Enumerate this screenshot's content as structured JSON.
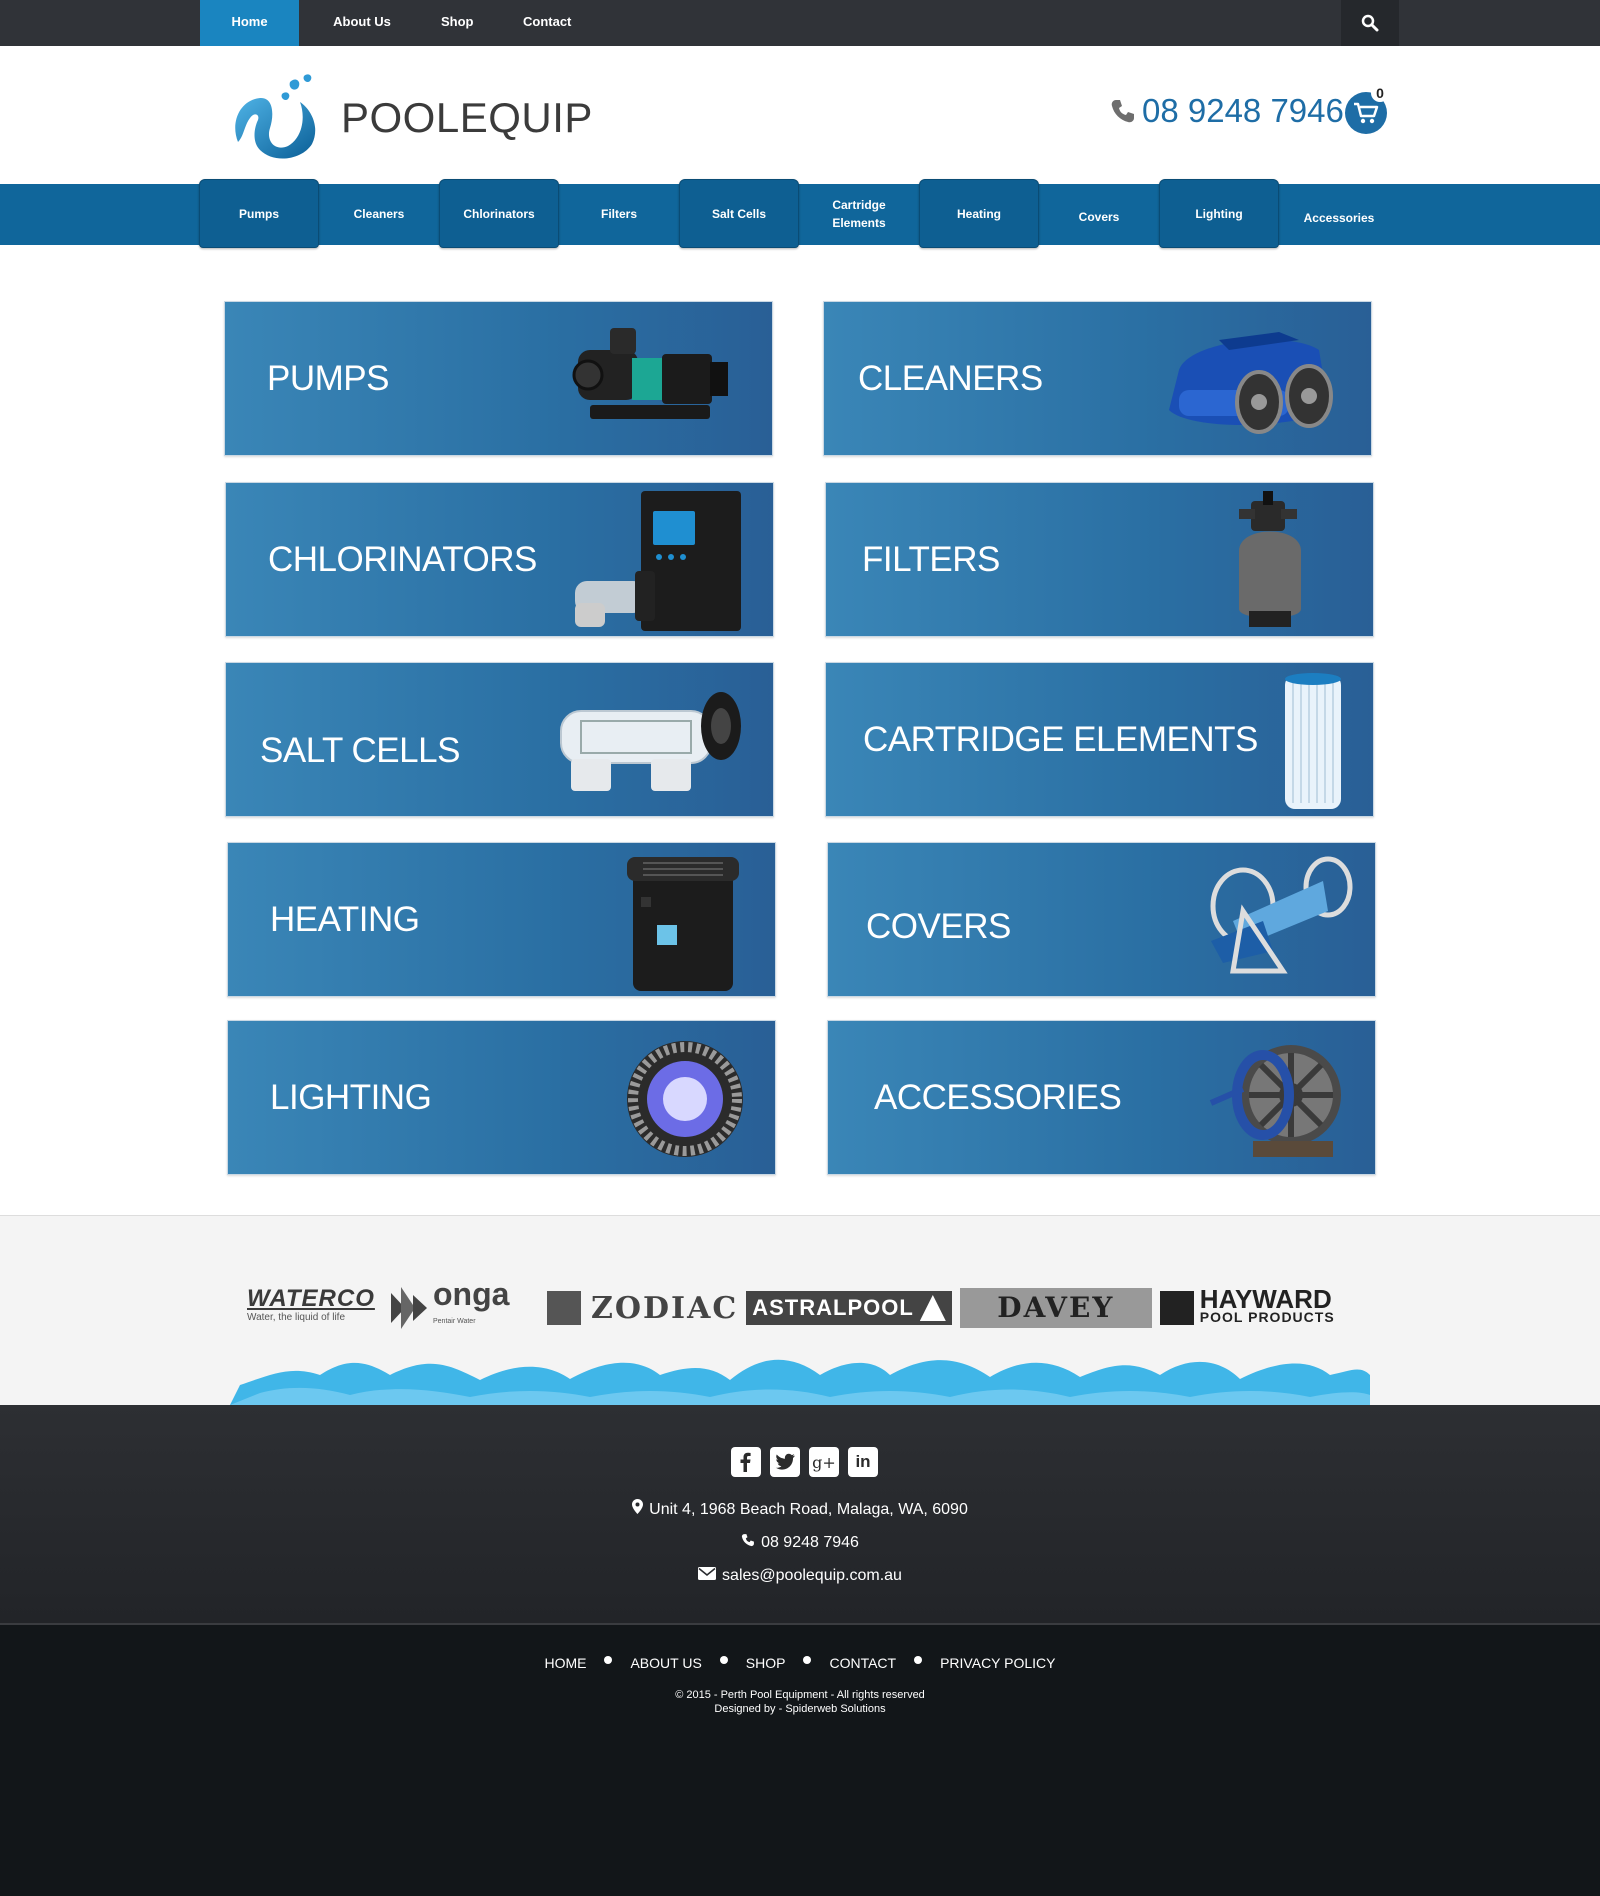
{
  "topnav": {
    "items": [
      "Home",
      "About Us",
      "Shop",
      "Contact"
    ]
  },
  "header": {
    "brand": "POOLEQUIP",
    "phone": "08 9248 7946",
    "cart_count": "0"
  },
  "mainnav": {
    "items": [
      "Pumps",
      "Cleaners",
      "Chlorinators",
      "Filters",
      "Salt Cells",
      "Cartridge Elements",
      "Heating",
      "Covers",
      "Lighting",
      "Accessories"
    ]
  },
  "categories": [
    "PUMPS",
    "CLEANERS",
    "CHLORINATORS",
    "FILTERS",
    "SALT CELLS",
    "CARTRIDGE ELEMENTS",
    "HEATING",
    "COVERS",
    "LIGHTING",
    "ACCESSORIES"
  ],
  "brands": {
    "waterco": "WATERCO",
    "waterco_tag": "Water, the liquid of life",
    "onga": "onga",
    "onga_tag": "Pentair Water",
    "zodiac": "ZODIAC",
    "astral": "ASTRALPOOL",
    "davey": "DAVEY",
    "hayward": "HAYWARD",
    "hayward_sub": "POOL PRODUCTS"
  },
  "footer": {
    "address": "Unit 4, 1968 Beach Road, Malaga, WA, 6090",
    "phone": "08 9248 7946",
    "email": "sales@poolequip.com.au",
    "links": [
      "HOME",
      "ABOUT US",
      "SHOP",
      "CONTACT",
      "PRIVACY POLICY"
    ],
    "copyright": "© 2015 - Perth Pool Equipment - All rights reserved",
    "designed": "Designed by - Spiderweb Solutions"
  },
  "colors": {
    "topbar": "#303338",
    "accent": "#1a85c0",
    "nav": "#10669b",
    "tile": "#2a6fa3",
    "footer": "#222428"
  }
}
